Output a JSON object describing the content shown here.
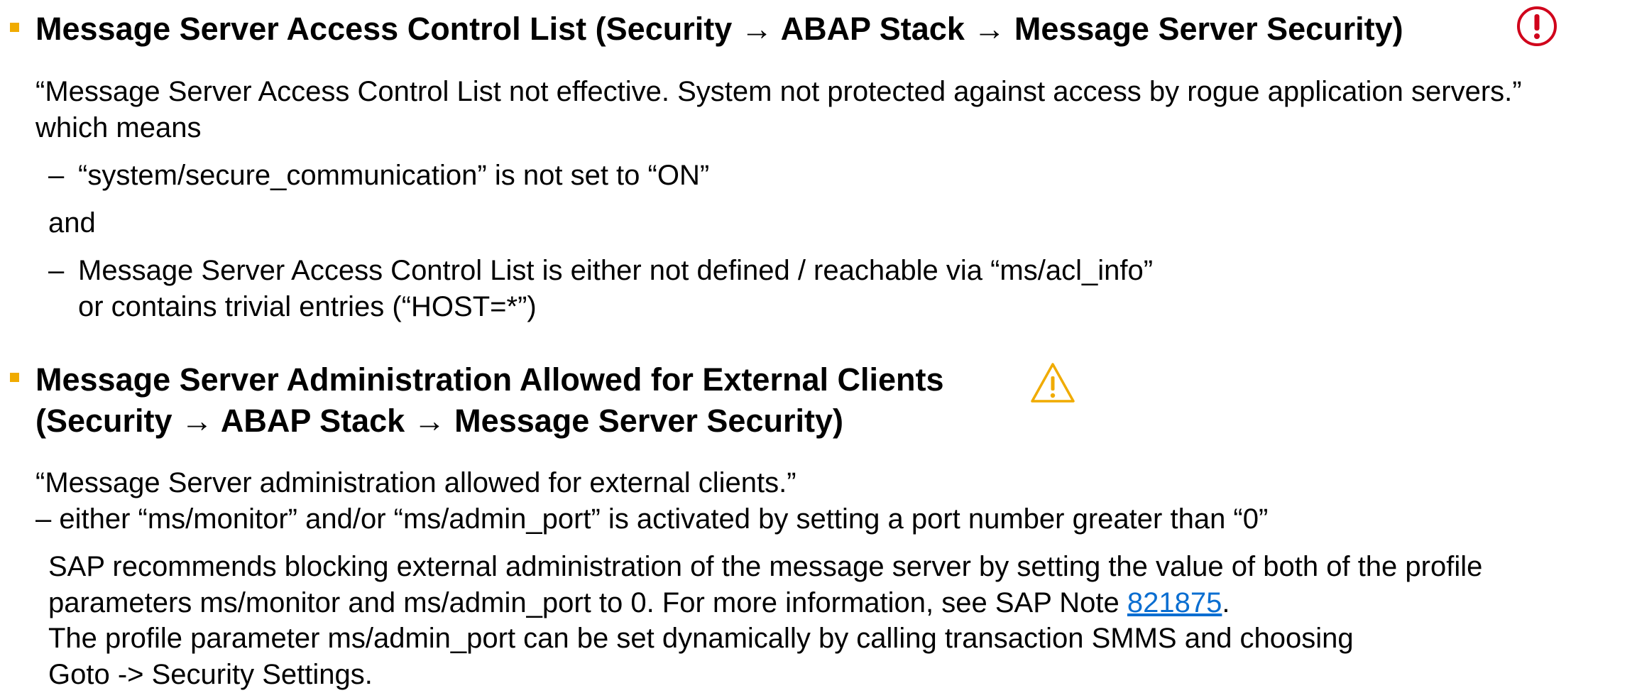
{
  "section1": {
    "title": "Message Server Access Control List (Security → ABAP Stack → Message Server Security)",
    "status_icon": "error-exclamation-circle-icon",
    "status_color": "#d0021b",
    "quote": "“Message Server Access Control List not effective. System not protected against access by rogue application servers.”",
    "which_means": "which means",
    "condition1_dash": "–",
    "condition1": "“system/secure_communication” is not set to “ON”",
    "and": "and",
    "condition2_dash": "–",
    "condition2_line1": "Message Server Access Control List is either not defined / reachable via “ms/acl_info”",
    "condition2_line2": "or contains trivial entries (“HOST=*”)"
  },
  "section2": {
    "title_line1": "Message Server Administration Allowed for External Clients",
    "title_line2": "(Security → ABAP Stack → Message Server Security)",
    "status_icon": "warning-triangle-icon",
    "status_color": "#f0ab00",
    "quote": "“Message Server administration allowed for external clients.”",
    "condition": "– either “ms/monitor” and/or “ms/admin_port” is activated by setting a port number greater than “0”",
    "rec_line1": "SAP recommends blocking external administration of the message server by setting the value of both of the profile",
    "rec_line2_prefix": "parameters ms/monitor and ms/admin_port to 0. For more information, see SAP Note ",
    "note_link": "821875",
    "rec_line2_suffix": ".",
    "rec_line3": "The profile parameter ms/admin_port can be set dynamically by calling transaction SMMS and choosing",
    "rec_line4": "Goto -> Security Settings."
  },
  "colors": {
    "bullet": "#f0ab00",
    "link": "#0a6ed1",
    "error": "#d0021b",
    "warning": "#f0ab00"
  }
}
